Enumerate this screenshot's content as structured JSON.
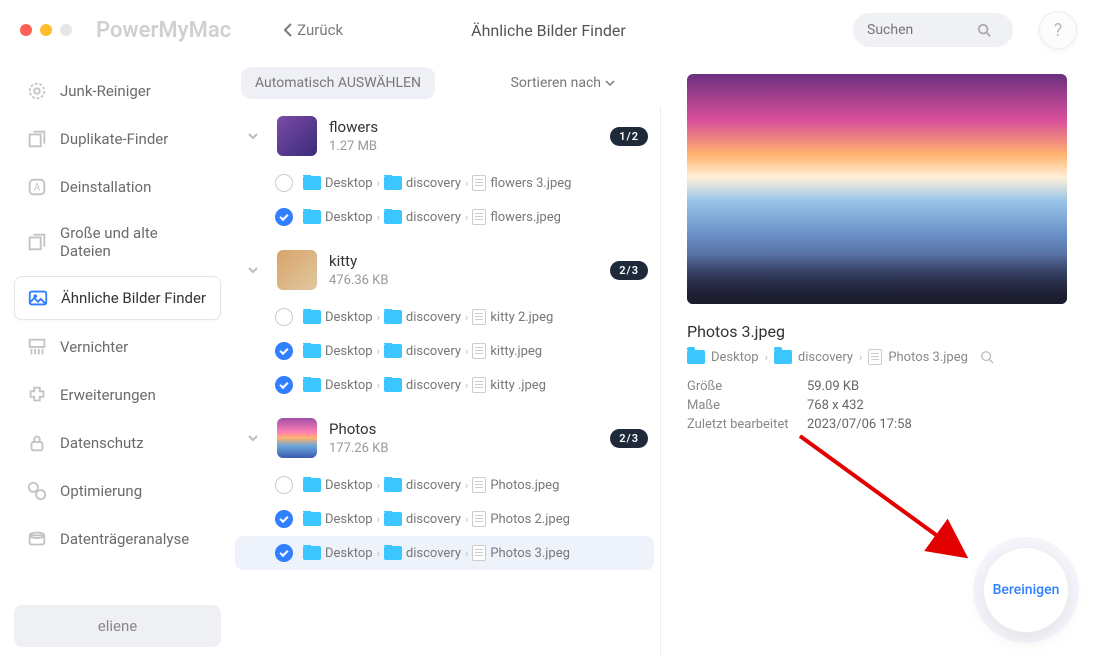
{
  "app_name": "PowerMyMac",
  "back_label": "Zurück",
  "page_title": "Ähnliche Bilder Finder",
  "search_placeholder": "Suchen",
  "help_label": "?",
  "nav": [
    {
      "id": "junk",
      "label": "Junk-Reiniger"
    },
    {
      "id": "dup",
      "label": "Duplikate-Finder"
    },
    {
      "id": "uninstall",
      "label": "Deinstallation"
    },
    {
      "id": "large",
      "label": "Große und alte Dateien"
    },
    {
      "id": "similar",
      "label": "Ähnliche Bilder Finder"
    },
    {
      "id": "shred",
      "label": "Vernichter"
    },
    {
      "id": "ext",
      "label": "Erweiterungen"
    },
    {
      "id": "privacy",
      "label": "Datenschutz"
    },
    {
      "id": "opt",
      "label": "Optimierung"
    },
    {
      "id": "disk",
      "label": "Datenträgeranalyse"
    }
  ],
  "active_nav": "similar",
  "user_name": "eliene",
  "auto_select": "Automatisch AUSWÄHLEN",
  "sort_label": "Sortieren nach",
  "path_segments": [
    "Desktop",
    "discovery"
  ],
  "groups": [
    {
      "name": "flowers",
      "size": "1.27 MB",
      "badge": "1/2",
      "thumb": "flowers",
      "items": [
        {
          "file": "flowers 3.jpeg",
          "checked": false,
          "sel": false
        },
        {
          "file": "flowers.jpeg",
          "checked": true,
          "sel": false
        }
      ]
    },
    {
      "name": "kitty",
      "size": "476.36 KB",
      "badge": "2/3",
      "thumb": "kitty",
      "items": [
        {
          "file": "kitty 2.jpeg",
          "checked": false,
          "sel": false
        },
        {
          "file": "kitty.jpeg",
          "checked": true,
          "sel": false
        },
        {
          "file": "kitty .jpeg",
          "checked": true,
          "sel": false
        }
      ]
    },
    {
      "name": "Photos",
      "size": "177.26 KB",
      "badge": "2/3",
      "thumb": "photos",
      "items": [
        {
          "file": "Photos.jpeg",
          "checked": false,
          "sel": false
        },
        {
          "file": "Photos 2.jpeg",
          "checked": true,
          "sel": false
        },
        {
          "file": "Photos 3.jpeg",
          "checked": true,
          "sel": true
        }
      ]
    }
  ],
  "preview": {
    "filename": "Photos 3.jpeg",
    "path_file": "Photos 3.jpeg",
    "size_label": "Größe",
    "size": "59.09 KB",
    "dim_label": "Maße",
    "dim": "768 x 432",
    "mod_label": "Zuletzt bearbeitet",
    "mod": "2023/07/06 17:58"
  },
  "clean_label": "Bereinigen"
}
